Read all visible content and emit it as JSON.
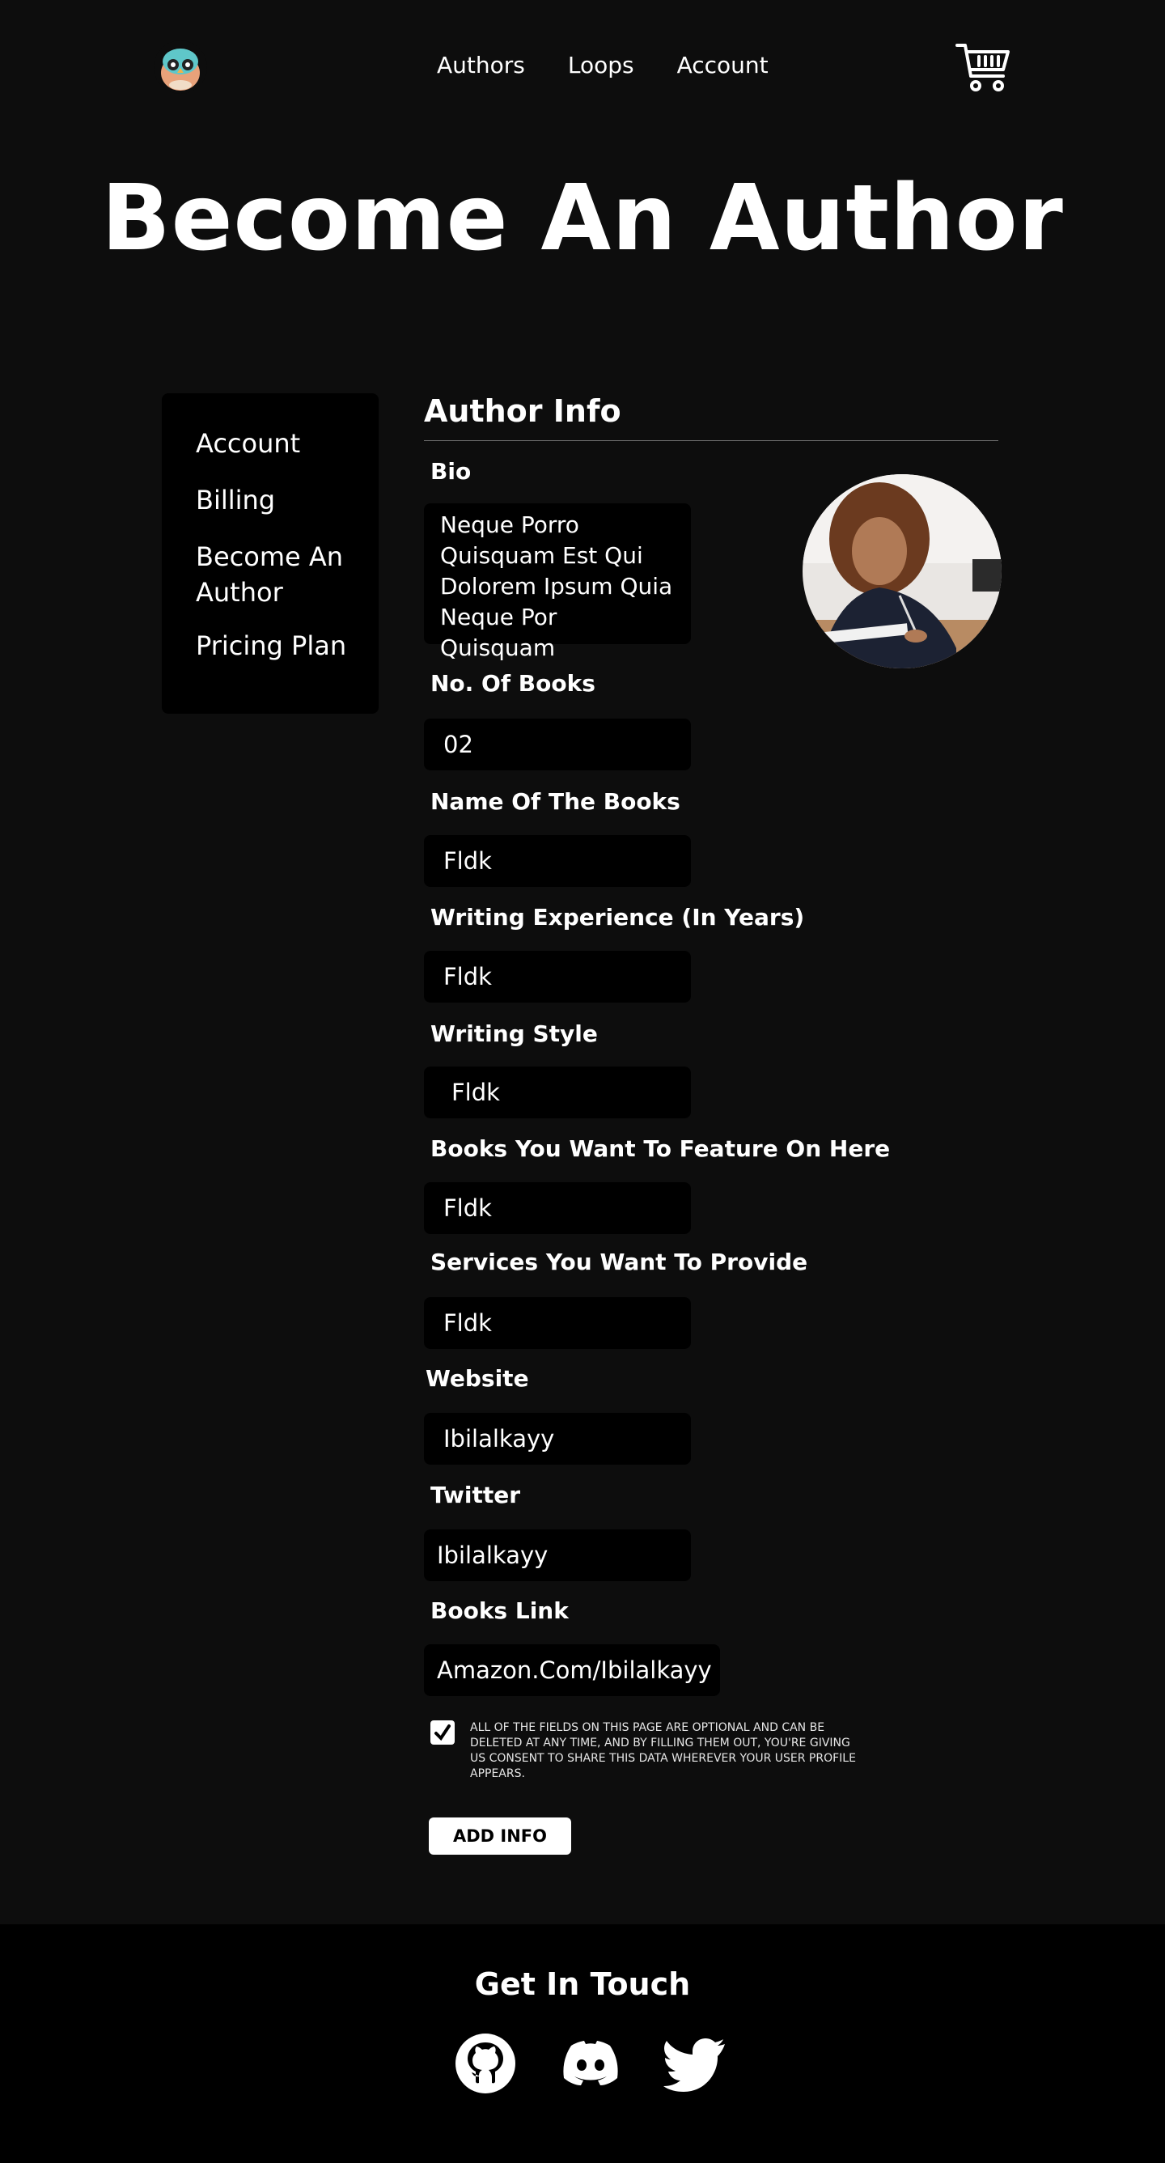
{
  "nav": {
    "links": [
      "Authors",
      "Loops",
      "Account"
    ]
  },
  "page_title": "Become An Author",
  "sidebar": {
    "items": [
      "Account",
      "Billing",
      "Become An Author",
      "Pricing Plan"
    ]
  },
  "form": {
    "section_title": "Author Info",
    "bio_label": "Bio",
    "bio_value": "Neque Porro Quisquam Est Qui Dolorem Ipsum Quia Neque Por Quisquam",
    "books_count_label": "No. Of Books",
    "books_count_value": "02",
    "book_names_label": "Name Of The Books",
    "book_names_value": "Fldk",
    "experience_label": "Writing Experience (In Years)",
    "experience_value": "Fldk",
    "style_label": "Writing Style",
    "style_value": "Fldk",
    "feature_label": "Books You Want To Feature On  Here",
    "feature_value": "Fldk",
    "services_label": "Services You Want To Provide",
    "services_value": "Fldk",
    "website_label": "Website",
    "website_value": "Ibilalkayy",
    "twitter_label": "Twitter",
    "twitter_value": "Ibilalkayy",
    "books_link_label": "Books Link",
    "books_link_value": "Amazon.Com/Ibilalkayy",
    "consent_text": "All of the fields on this page are optional and can be deleted at any time, and by filling them out, you're giving us consent to share this data wherever your user profile appears.",
    "consent_checked": true,
    "submit_label": "ADD INFO"
  },
  "footer": {
    "title": "Get In Touch",
    "social_icons": [
      "github-icon",
      "discord-icon",
      "twitter-icon"
    ]
  },
  "colors": {
    "background": "#0d0d0d",
    "panel": "#000000",
    "text": "#ffffff"
  }
}
